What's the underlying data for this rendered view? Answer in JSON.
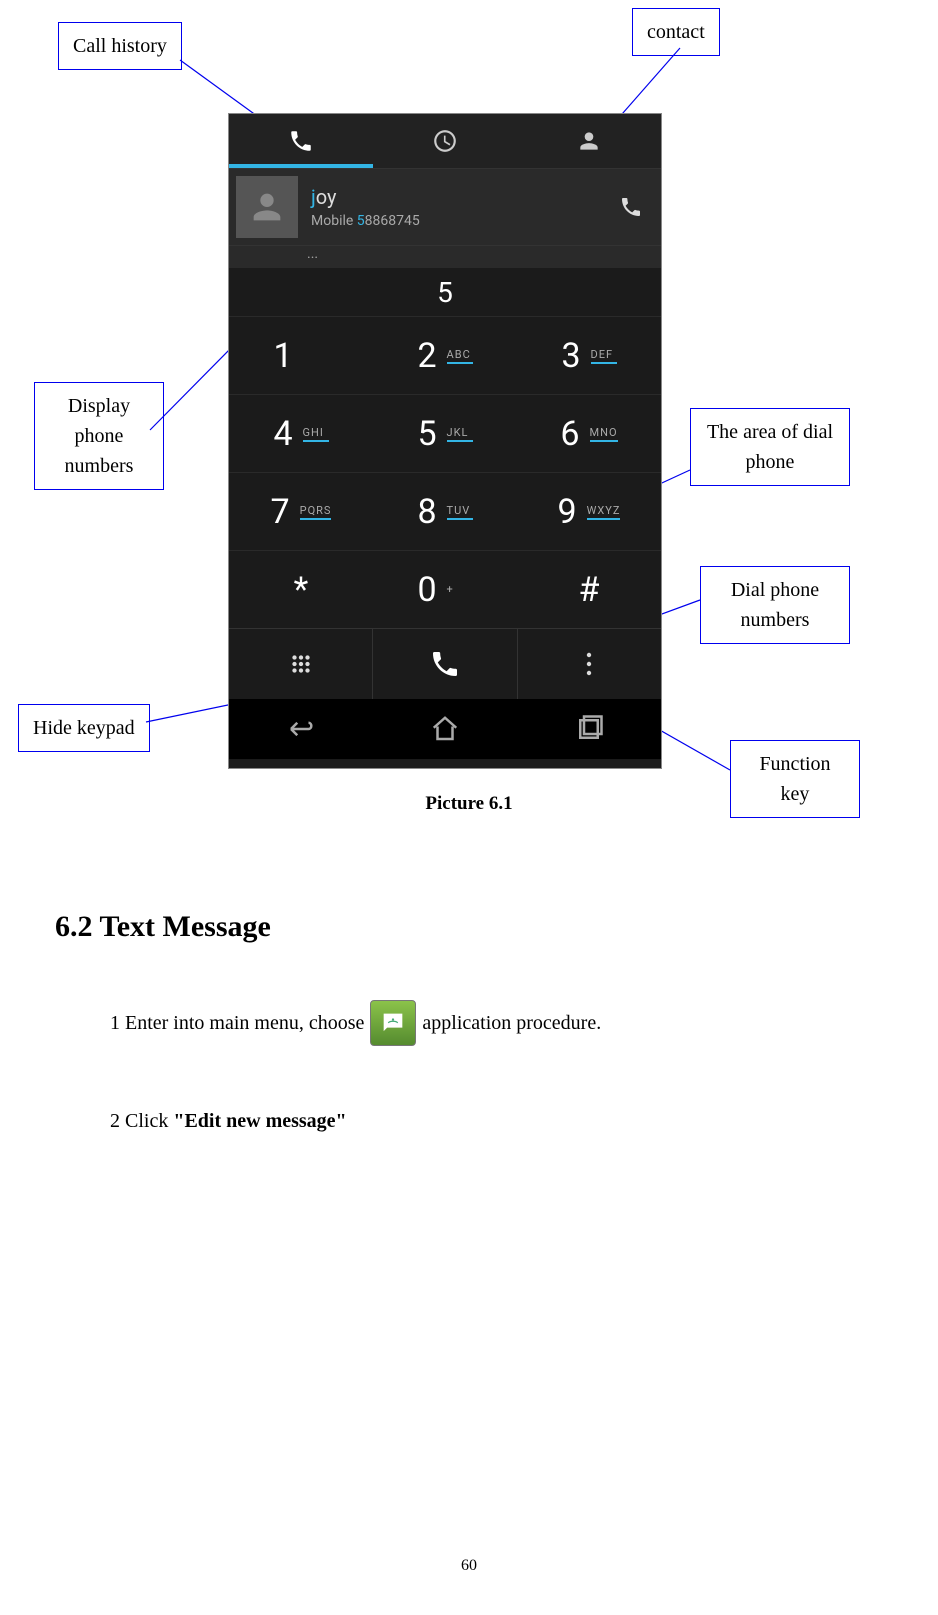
{
  "callouts": {
    "call_history": "Call history",
    "contact": "contact",
    "display_phone_numbers": "Display phone numbers",
    "area_dial_phone": "The area of dial phone",
    "dial_phone_numbers": "Dial phone numbers",
    "hide_keypad": "Hide keypad",
    "function_key": "Function key"
  },
  "phone": {
    "contact_name_match": "j",
    "contact_name_rest": "oy",
    "contact_phone_prefix": "Mobile ",
    "contact_phone_match": "5",
    "contact_phone_rest": "8868745",
    "ellipsis": "...",
    "typed_number": "5",
    "keys": [
      {
        "digit": "1",
        "letters": ""
      },
      {
        "digit": "2",
        "letters": "ABC"
      },
      {
        "digit": "3",
        "letters": "DEF"
      },
      {
        "digit": "4",
        "letters": "GHI"
      },
      {
        "digit": "5",
        "letters": "JKL"
      },
      {
        "digit": "6",
        "letters": "MNO"
      },
      {
        "digit": "7",
        "letters": "PQRS"
      },
      {
        "digit": "8",
        "letters": "TUV"
      },
      {
        "digit": "9",
        "letters": "WXYZ"
      },
      {
        "digit": "*",
        "letters": ""
      },
      {
        "digit": "0",
        "letters": "+"
      },
      {
        "digit": "#",
        "letters": ""
      }
    ]
  },
  "caption": "Picture 6.1",
  "section": "6.2 Text Message",
  "step1_before": "1 Enter into main menu, choose ",
  "step1_after": " application procedure.",
  "step2_before": "2 Click ",
  "step2_bold": "\"Edit new message\"",
  "page_number": "60"
}
